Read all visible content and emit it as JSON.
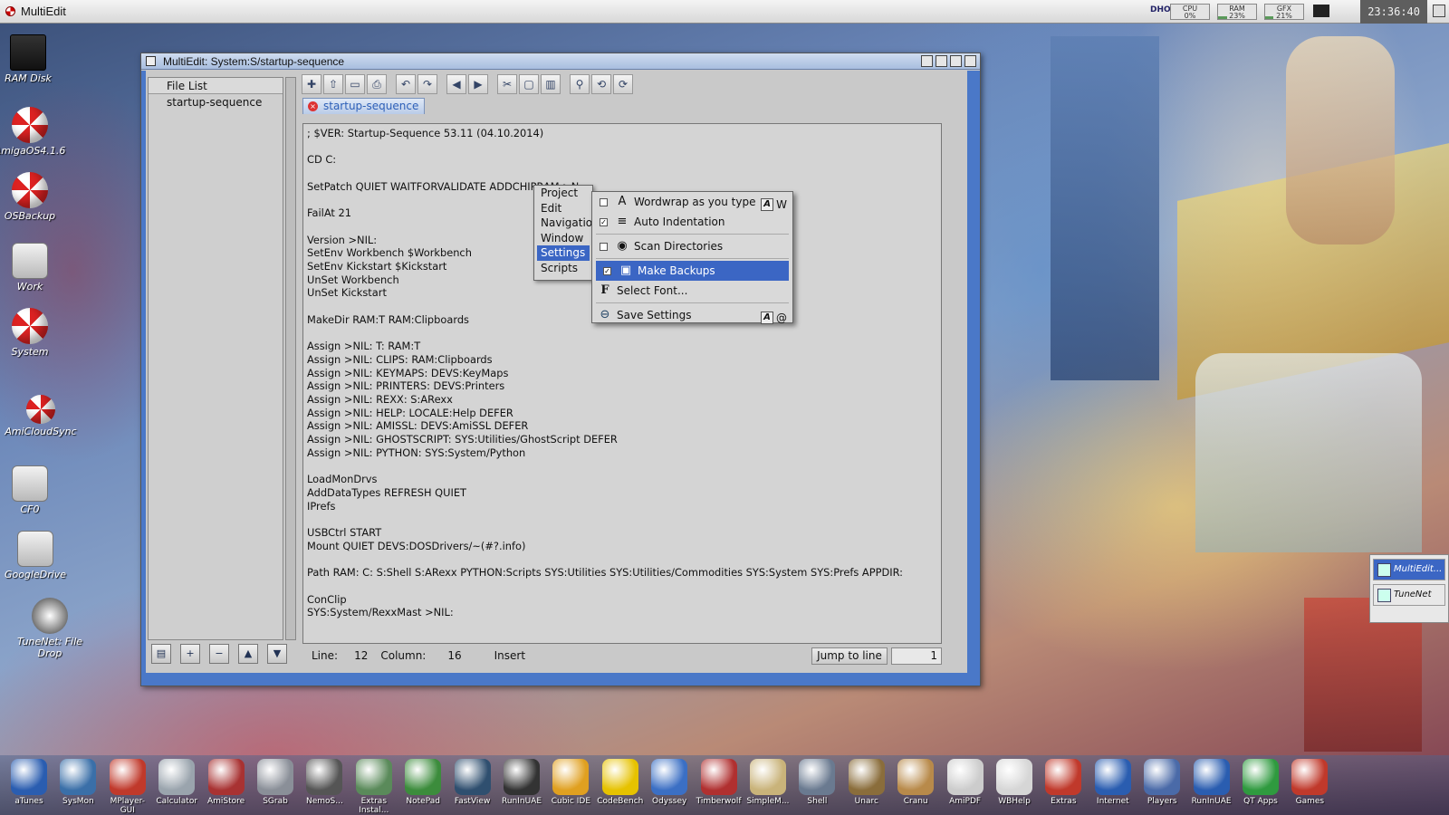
{
  "topbar": {
    "title": "MultiEdit",
    "dho": "DHO",
    "meters": [
      {
        "name": "cpu-meter",
        "label": "CPU",
        "value": "0%",
        "fraction": 0.0
      },
      {
        "name": "ram-meter",
        "label": "RAM",
        "value": "23%",
        "fraction": 0.23
      },
      {
        "name": "gfx-meter",
        "label": "GFX",
        "value": "21%",
        "fraction": 0.21
      }
    ],
    "clock": "23:36:40"
  },
  "desktop_icons": [
    {
      "name": "ram-disk-icon",
      "label": "RAM Disk",
      "kind": "ramdisk"
    },
    {
      "name": "amigaos-icon",
      "label": "AmigaOS4.1.6",
      "kind": "ball"
    },
    {
      "name": "osbackup-icon",
      "label": "OSBackup",
      "kind": "ball"
    },
    {
      "name": "work-icon",
      "label": "Work",
      "kind": "drive"
    },
    {
      "name": "system-icon",
      "label": "System",
      "kind": "ball"
    },
    {
      "name": "amicloudsync-icon",
      "label": "AmiCloudSync",
      "kind": "ball"
    },
    {
      "name": "cf0-icon",
      "label": "CF0",
      "kind": "drive"
    },
    {
      "name": "googledrive-icon",
      "label": "GoogleDrive",
      "kind": "drive"
    },
    {
      "name": "tunenet-filedrop-icon",
      "label": "TuneNet: File Drop",
      "kind": "ball"
    }
  ],
  "window": {
    "title": "MultiEdit: System:S/startup-sequence",
    "file_list": {
      "header": "File List",
      "items": [
        "startup-sequence"
      ]
    },
    "tab_label": "startup-sequence",
    "editor_text": "; $VER: Startup-Sequence 53.11 (04.10.2014)\n\nCD C:\n\nSetPatch QUIET WAITFORVALIDATE ADDCHIPRAM >N\n\nFailAt 21\n\nVersion >NIL:\nSetEnv Workbench $Workbench\nSetEnv Kickstart $Kickstart\nUnSet Workbench\nUnSet Kickstart\n\nMakeDir RAM:T RAM:Clipboards\n\nAssign >NIL: T: RAM:T\nAssign >NIL: CLIPS: RAM:Clipboards\nAssign >NIL: KEYMAPS: DEVS:KeyMaps\nAssign >NIL: PRINTERS: DEVS:Printers\nAssign >NIL: REXX: S:ARexx\nAssign >NIL: HELP: LOCALE:Help DEFER\nAssign >NIL: AMISSL: DEVS:AmiSSL DEFER\nAssign >NIL: GHOSTSCRIPT: SYS:Utilities/GhostScript DEFER\nAssign >NIL: PYTHON: SYS:System/Python\n\nLoadMonDrvs\nAddDataTypes REFRESH QUIET\nIPrefs\n\nUSBCtrl START\nMount QUIET DEVS:DOSDrivers/~(#?.info)\n\nPath RAM: C: S:Shell S:ARexx PYTHON:Scripts SYS:Utilities SYS:Utilities/Commodities SYS:System SYS:Prefs APPDIR:\n\nConClip\nSYS:System/RexxMast >NIL:",
    "status": {
      "line_label": "Line:",
      "line_value": "12",
      "column_label": "Column:",
      "column_value": "16",
      "mode": "Insert",
      "jump_button": "Jump to line",
      "jump_value": "1"
    }
  },
  "menu": {
    "items": [
      "Project",
      "Edit",
      "Navigation",
      "Window",
      "Settings",
      "Scripts"
    ],
    "selected": "Settings"
  },
  "settings_submenu": [
    {
      "name": "wordwrap",
      "label": "Wordwrap as you type",
      "checkbox": true,
      "checked": false,
      "icon": "A",
      "shortcut": "W"
    },
    {
      "name": "auto-indentation",
      "label": "Auto Indentation",
      "checkbox": true,
      "checked": true,
      "icon": "≡",
      "shortcut": ""
    },
    {
      "name": "scan-directories",
      "label": "Scan Directories",
      "checkbox": true,
      "checked": false,
      "icon": "◉",
      "shortcut": ""
    },
    {
      "name": "make-backups",
      "label": "Make Backups",
      "checkbox": true,
      "checked": true,
      "icon": "▣",
      "shortcut": "",
      "selected": true
    },
    {
      "name": "select-font",
      "label": "Select Font...",
      "checkbox": false,
      "icon": "F",
      "shortcut": ""
    },
    {
      "name": "save-settings",
      "label": "Save Settings",
      "checkbox": false,
      "icon": "⊖",
      "shortcut": "@"
    }
  ],
  "side_panel": [
    "MultiEdit...",
    "TuneNet"
  ],
  "dock": [
    "aTunes",
    "SysMon",
    "MPlayer-GUI",
    "Calculator",
    "AmiStore",
    "SGrab",
    "NemoS...",
    "Extras Instal...",
    "NotePad",
    "FastView",
    "RunInUAE",
    "Cubic IDE",
    "CodeBench",
    "Odyssey",
    "Timberwolf",
    "SimpleM...",
    "Shell",
    "Unarc",
    "Cranu",
    "AmiPDF",
    "WBHelp",
    "Extras",
    "Internet",
    "Players",
    "RunInUAE",
    "QT Apps",
    "Games"
  ],
  "colors": {
    "accent": "#3b66c4",
    "window_border": "#4a78c8"
  }
}
